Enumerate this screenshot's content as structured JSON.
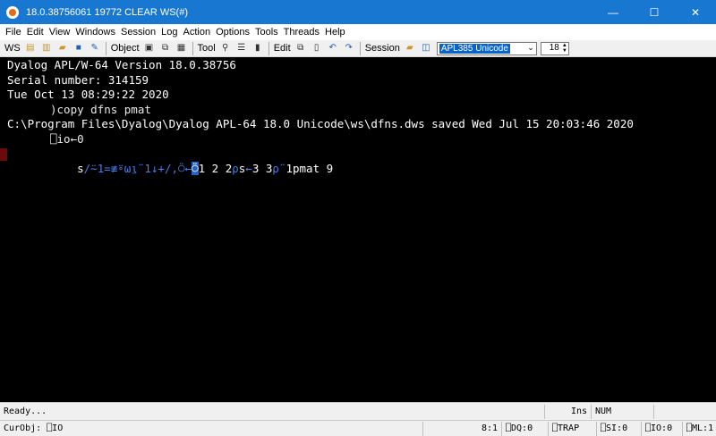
{
  "window": {
    "title": "18.0.38756061 19772 CLEAR WS(#)",
    "controls": {
      "minimize": "—",
      "maximize": "☐",
      "close": "✕"
    }
  },
  "menu": [
    "File",
    "Edit",
    "View",
    "Windows",
    "Session",
    "Log",
    "Action",
    "Options",
    "Tools",
    "Threads",
    "Help"
  ],
  "toolbar": {
    "ws_label": "WS",
    "object_label": "Object",
    "tool_label": "Tool",
    "edit_label": "Edit",
    "session_label": "Session",
    "font_name": "APL385 Unicode",
    "font_size": "18",
    "icons": {
      "ws": [
        "load-ws-icon",
        "copy-ws-icon",
        "open-ws-icon",
        "save-ws-icon",
        "save-as-icon"
      ],
      "object": [
        "print-icon",
        "copy-object-icon",
        "explorer-icon"
      ],
      "tool": [
        "find-icon",
        "workspace-explorer-icon",
        "chart-icon"
      ],
      "edit": [
        "copy-icon",
        "paste-icon",
        "undo-icon",
        "redo-icon"
      ],
      "session": [
        "session-folder-icon",
        "session-font-icon"
      ]
    }
  },
  "session": {
    "lines": [
      "Dyalog APL/W-64 Version 18.0.38756",
      "Serial number: 314159",
      "Tue Oct 13 08:29:22 2020",
      ")copy dfns pmat",
      "C:\\Program Files\\Dyalog\\Dyalog APL-64 18.0 Unicode\\ws\\dfns.dws saved Wed Jul 15 20:03:46 2020",
      "⎕io←0"
    ],
    "input_segments": [
      {
        "text": "s",
        "style": "num"
      },
      {
        "text": "/⍨1=≢⍤⍵⍸¨1↓+/,⍥←",
        "style": "prim"
      },
      {
        "text": "⍥",
        "style": "cursor"
      },
      {
        "text": "1 2 2",
        "style": "num"
      },
      {
        "text": "⍴",
        "style": "prim"
      },
      {
        "text": "s",
        "style": "num"
      },
      {
        "text": "←",
        "style": "prim"
      },
      {
        "text": "3 3",
        "style": "num"
      },
      {
        "text": "⍴¨",
        "style": "prim"
      },
      {
        "text": "1pmat 9",
        "style": "num"
      }
    ]
  },
  "status": {
    "state": "Ready...",
    "ins": "Ins",
    "num": "NUM",
    "curobj": "CurObj: ⎕IO",
    "position": "8:1",
    "dq": "⎕DQ:0",
    "trap": "⎕TRAP",
    "si": "⎕SI:0",
    "io": "⎕IO:0",
    "ml": "⎕ML:1"
  }
}
